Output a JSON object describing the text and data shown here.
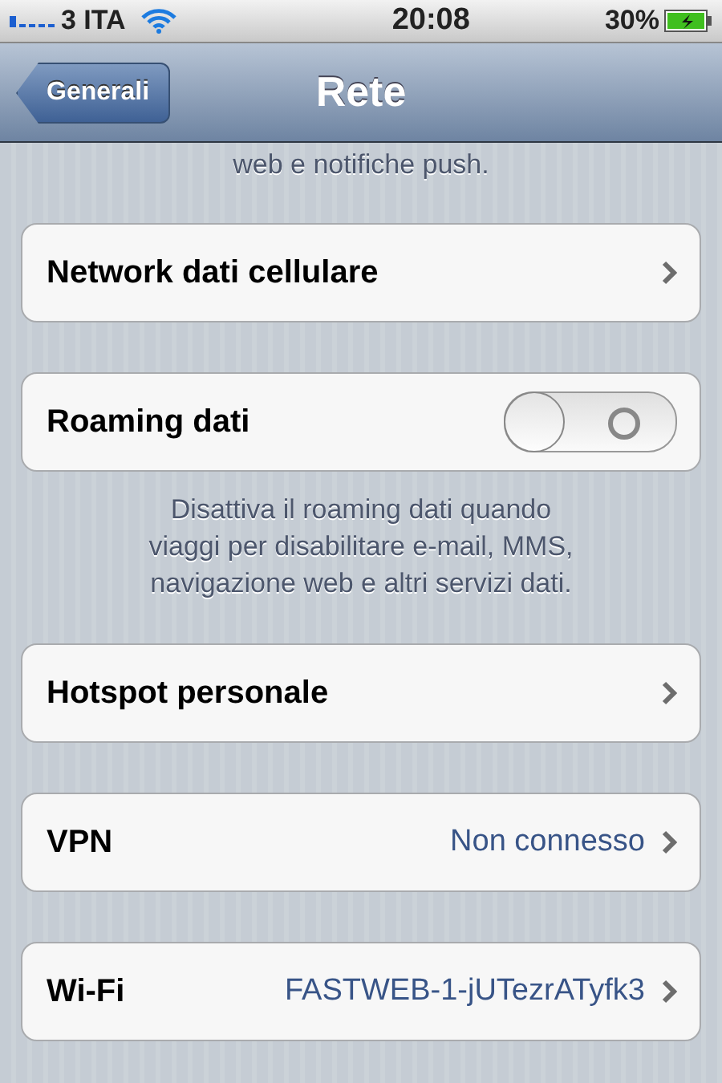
{
  "status_bar": {
    "carrier": "3 ITA",
    "time": "20:08",
    "battery": "30%"
  },
  "nav_bar": {
    "back": "Generali",
    "title": "Rete"
  },
  "top_note": "web e notifiche push.",
  "groups": [
    {
      "rows": [
        {
          "kind": "link",
          "label": "Network dati cellulare"
        }
      ]
    },
    {
      "rows": [
        {
          "kind": "switch",
          "label": "Roaming dati",
          "on": false
        }
      ],
      "footer": "Disattiva il roaming dati quando viaggi per disabilitare e-mail, MMS, navigazione web e altri servizi dati."
    },
    {
      "rows": [
        {
          "kind": "link",
          "label": "Hotspot personale"
        }
      ]
    },
    {
      "rows": [
        {
          "kind": "link",
          "label": "VPN",
          "value": "Non connesso"
        }
      ]
    },
    {
      "rows": [
        {
          "kind": "link",
          "label": "Wi-Fi",
          "value": "FASTWEB-1-jUTezrATyfk3"
        }
      ]
    }
  ]
}
